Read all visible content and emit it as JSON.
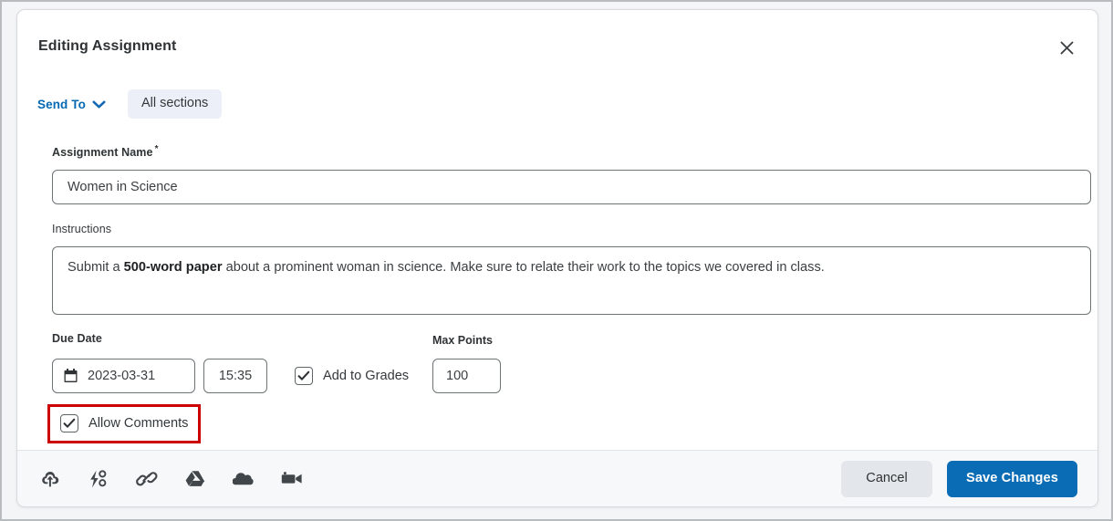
{
  "modal": {
    "title": "Editing Assignment",
    "close_icon": "close-icon"
  },
  "send_to": {
    "link_label": "Send To",
    "caret_icon": "chevron-down-icon",
    "chip_label": "All sections"
  },
  "fields": {
    "assignment_name": {
      "label": "Assignment Name",
      "required_marker": "*",
      "value": "Women in Science"
    },
    "instructions": {
      "label": "Instructions",
      "text_before": "Submit a ",
      "text_bold": "500-word paper",
      "text_after": " about a prominent woman in science. Make sure to relate their work to the topics we covered in class.",
      "value": "Submit a 500-word paper about a prominent woman in science. Make sure to relate their work to the topics we covered in class."
    },
    "due_date": {
      "label": "Due Date",
      "date_value": "2023-03-31",
      "time_value": "15:35",
      "calendar_icon": "calendar-icon"
    },
    "add_to_grades": {
      "label": "Add to Grades",
      "checked": "true"
    },
    "max_points": {
      "label": "Max Points",
      "value": "100"
    },
    "allow_comments": {
      "label": "Allow Comments",
      "checked": "true",
      "highlight_color": "#cc0000"
    }
  },
  "footer": {
    "icons": [
      {
        "name": "upload-cloud-icon"
      },
      {
        "name": "lightning-bolt-icon"
      },
      {
        "name": "link-chain-icon"
      },
      {
        "name": "google-drive-icon"
      },
      {
        "name": "onedrive-cloud-icon"
      },
      {
        "name": "video-camera-icon"
      }
    ],
    "cancel_label": "Cancel",
    "save_label": "Save Changes"
  },
  "colors": {
    "accent_blue": "#0a6cb4",
    "link_blue": "#0668b2",
    "chip_bg": "#eceff7",
    "footer_bg": "#f7f8fa",
    "border_gray": "#6e7376",
    "highlight_red": "#cc0000"
  }
}
